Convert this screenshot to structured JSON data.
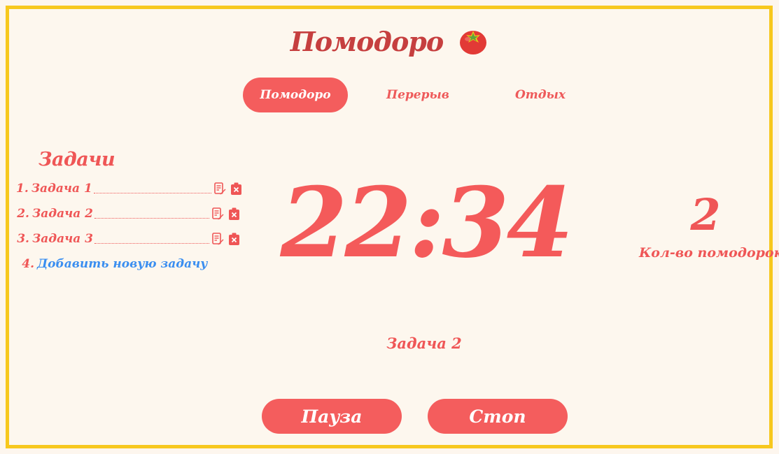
{
  "header": {
    "title": "Помодоро",
    "icon": "tomato-icon"
  },
  "tabs": [
    {
      "label": "Помодоро",
      "active": true
    },
    {
      "label": "Перерыв",
      "active": false
    },
    {
      "label": "Отдых",
      "active": false
    }
  ],
  "tasks": {
    "heading": "Задачи",
    "items": [
      {
        "number": "1.",
        "label": "Задача 1"
      },
      {
        "number": "2.",
        "label": "Задача 2"
      },
      {
        "number": "3.",
        "label": "Задача 3"
      }
    ],
    "add": {
      "number": "4.",
      "label": "Добавить новую задачу"
    }
  },
  "timer": {
    "value": "22:34"
  },
  "counter": {
    "value": "2",
    "label": "Кол-во помодорок"
  },
  "current_task": "Задача 2",
  "controls": {
    "pause_label": "Пауза",
    "stop_label": "Стоп"
  },
  "colors": {
    "accent": "#f45d5d",
    "frame": "#f7c81e",
    "background": "#fdf7ee",
    "link": "#3a8ef0"
  }
}
